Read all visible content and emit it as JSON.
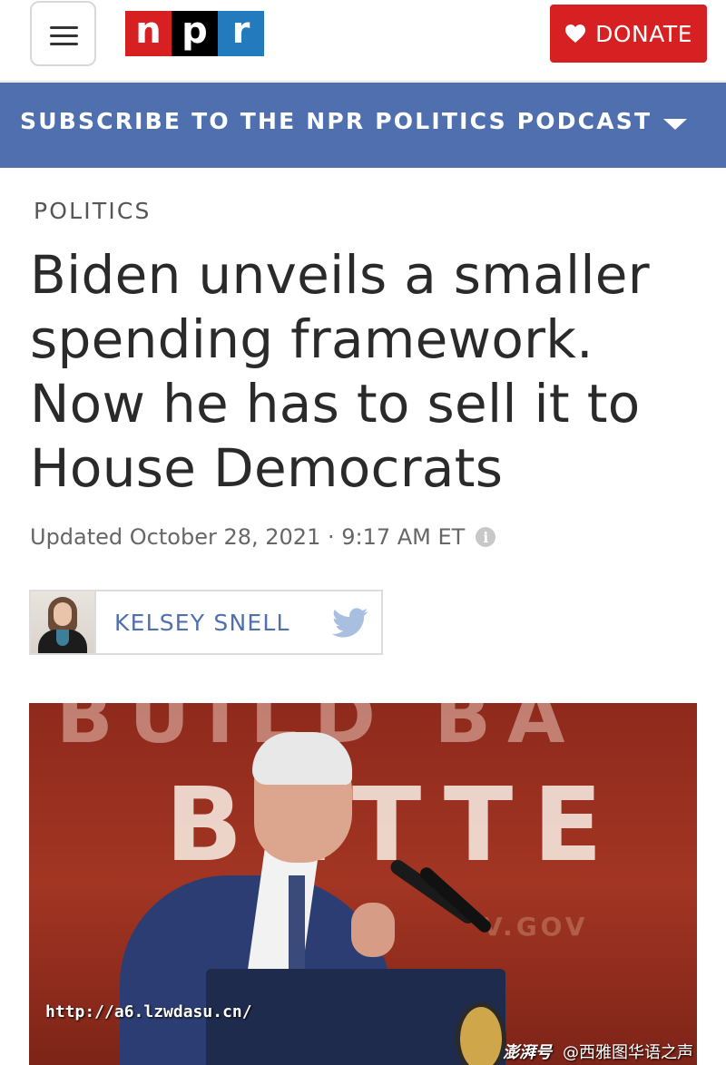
{
  "header": {
    "menu_icon": "hamburger-menu-icon",
    "logo_letters": [
      "n",
      "p",
      "r"
    ],
    "logo_colors": [
      "#d62021",
      "#000000",
      "#237bbd"
    ],
    "donate_label": "DONATE",
    "donate_icon": "heart-icon",
    "accent_color": "#d62021"
  },
  "subscribe": {
    "label": "SUBSCRIBE TO THE NPR POLITICS PODCAST",
    "icon": "chevron-down-icon",
    "background": "#4f6fae"
  },
  "article": {
    "section": "POLITICS",
    "headline": "Biden unveils a smaller spending framework. Now he has to sell it to House Democrats",
    "dateline": "Updated October 28, 2021 · 9:17 AM ET",
    "info_icon": "info-icon",
    "author": {
      "name": "KELSEY SNELL",
      "social_icon": "twitter-icon"
    }
  },
  "photo": {
    "sign_top": "BUILD BA",
    "sign_main": "BETTE",
    "sign_small": "V.GOV",
    "watermark_url": "http://a6.lzwdasu.cn/",
    "watermark_brand": "澎湃号",
    "watermark_source": "@西雅图华语之声"
  }
}
